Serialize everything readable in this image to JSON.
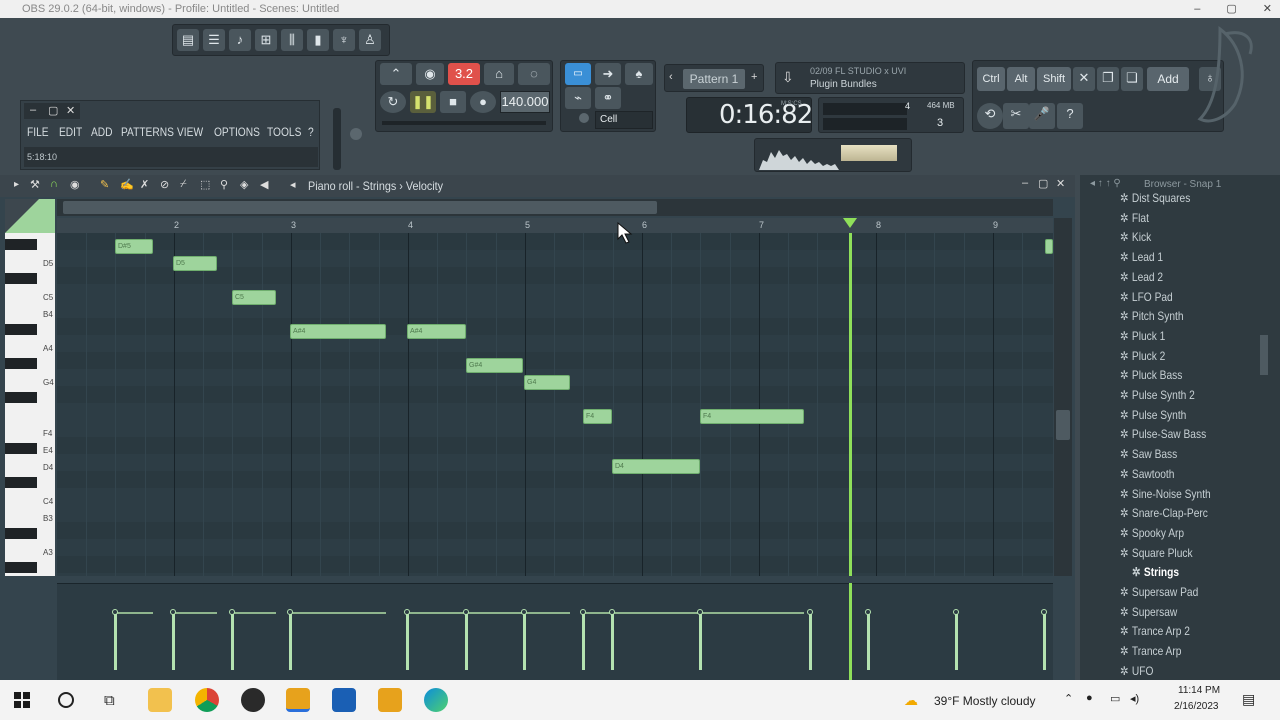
{
  "window": {
    "title": "OBS 29.0.2 (64-bit, windows) - Profile: Untitled - Scenes: Untitled"
  },
  "menu": {
    "items": [
      "FILE",
      "EDIT",
      "ADD",
      "PATTERNS",
      "VIEW",
      "OPTIONS",
      "TOOLS",
      "?"
    ],
    "hint": "5:18:10"
  },
  "transport": {
    "mode_label": "3.2",
    "tempo": "140.000",
    "pattern": "Pattern 1",
    "time": "0:16:82",
    "time_unit": "M:S:CS",
    "snap_label": "Cell",
    "memory": "464 MB",
    "voices": "3",
    "cpu": "4"
  },
  "news": {
    "line1": "02/09  FL STUDIO x UVI",
    "line2": "Plugin Bundles"
  },
  "toolbar_right": {
    "ctrl": "Ctrl",
    "alt": "Alt",
    "shift": "Shift",
    "add": "Add"
  },
  "pianoroll": {
    "title": "Piano roll - Strings › Velocity",
    "bars": [
      "2",
      "3",
      "4",
      "5",
      "6",
      "7",
      "8",
      "9"
    ]
  },
  "keys": [
    "D5",
    "C5",
    "B4",
    "A4",
    "G4",
    "F4",
    "E4",
    "D4",
    "C4",
    "B3",
    "A3"
  ],
  "notes": [
    {
      "label": "D#5"
    },
    {
      "label": "D5"
    },
    {
      "label": "C5"
    },
    {
      "label": "A#4"
    },
    {
      "label": "A#4"
    },
    {
      "label": "G#4"
    },
    {
      "label": "G4"
    },
    {
      "label": "F4"
    },
    {
      "label": "D4"
    },
    {
      "label": "F4"
    }
  ],
  "browser": {
    "header": "Browser - Snap 1",
    "items": [
      "Dist Squares",
      "Flat",
      "Kick",
      "Lead 1",
      "Lead 2",
      "LFO Pad",
      "Pitch Synth",
      "Pluck 1",
      "Pluck 2",
      "Pluck Bass",
      "Pulse Synth 2",
      "Pulse Synth",
      "Pulse-Saw Bass",
      "Saw Bass",
      "Sawtooth",
      "Sine-Noise Synth",
      "Snare-Clap-Perc",
      "Spooky Arp",
      "Square Pluck",
      "Strings",
      "Supersaw Pad",
      "Supersaw",
      "Trance Arp 2",
      "Trance Arp",
      "UFO"
    ],
    "selected": "Strings"
  },
  "taskbar": {
    "weather": "39°F  Mostly cloudy",
    "time": "11:14 PM",
    "date": "2/16/2023"
  },
  "colors": {
    "note": "#9ed49c",
    "playhead": "#8fe05a",
    "record": "#e0514b",
    "bg": "#3f4a51"
  }
}
